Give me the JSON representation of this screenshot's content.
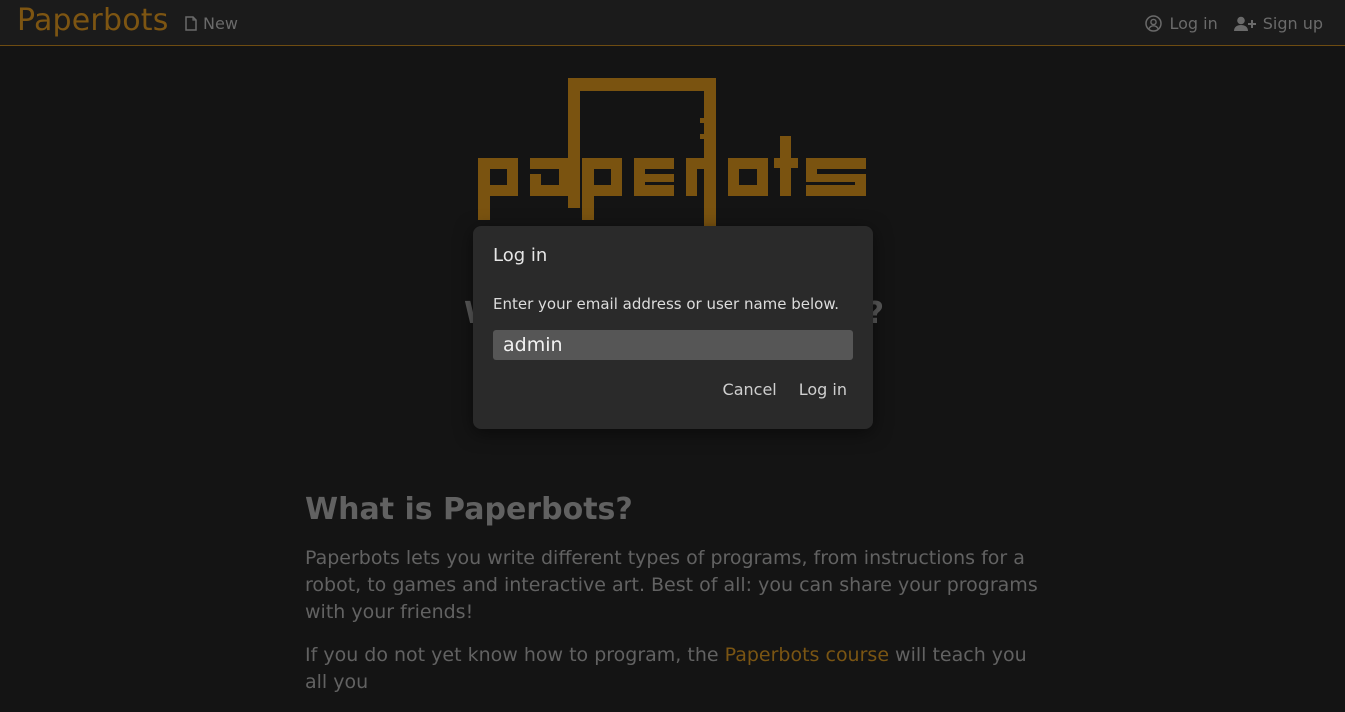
{
  "header": {
    "brand": "Paperbots",
    "new_label": "New",
    "login_label": "Log in",
    "signup_label": "Sign up"
  },
  "hero": {
    "logo_text": "paperbots",
    "obscured_heading_start": "W",
    "obscured_heading_end": "?"
  },
  "main": {
    "heading": "What is Paperbots?",
    "paragraph1": "Paperbots lets you write different types of programs, from instructions for a robot, to games and interactive art. Best of all: you can share your programs with your friends!",
    "paragraph2_before": "If you do not yet know how to program, the ",
    "paragraph2_link": "Paperbots course",
    "paragraph2_after": " will teach you all you"
  },
  "dialog": {
    "title": "Log in",
    "instructions": "Enter your email address or user name below.",
    "input_value": "admin",
    "cancel_label": "Cancel",
    "login_label": "Log in"
  },
  "colors": {
    "accent": "#7d5512",
    "background": "#141414",
    "dialog": "#2a2a2a"
  }
}
